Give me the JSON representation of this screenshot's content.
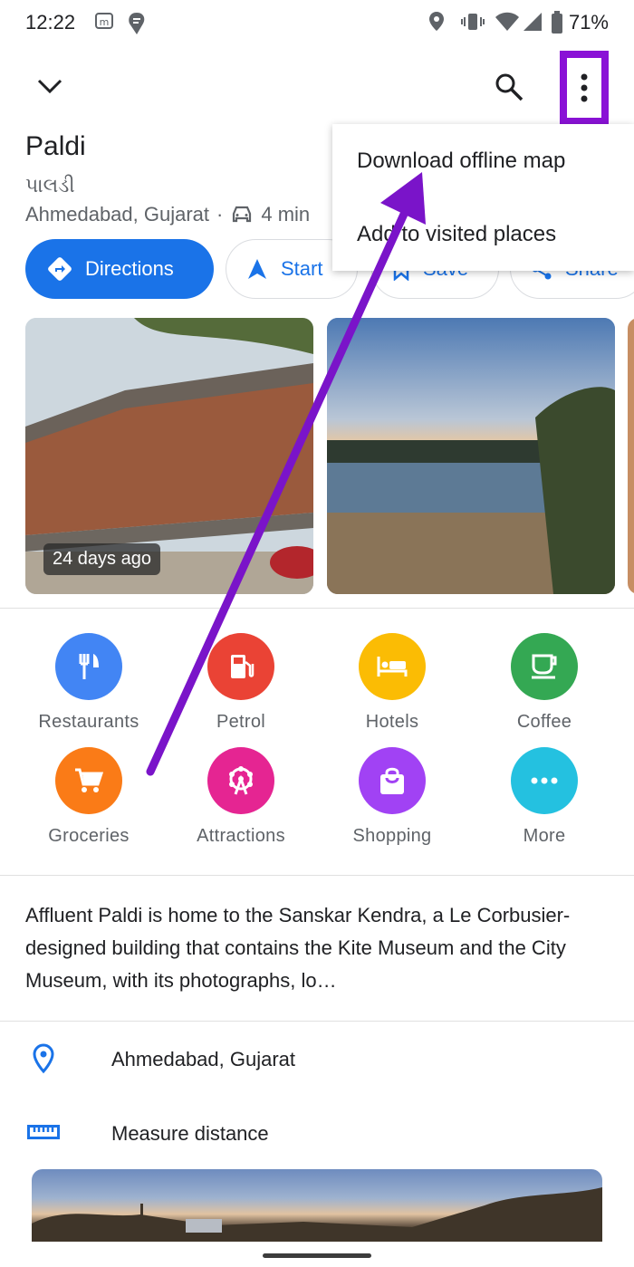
{
  "status_bar": {
    "time": "12:22",
    "battery": "71%"
  },
  "place": {
    "name": "Paldi",
    "local_name": "પાલડી",
    "location": "Ahmedabad, Gujarat",
    "separator": "·",
    "drive_time": "4 min"
  },
  "actions": [
    {
      "label": "Directions",
      "icon": "directions-icon"
    },
    {
      "label": "Start",
      "icon": "navigation-arrow-icon"
    },
    {
      "label": "Save",
      "icon": "bookmark-icon"
    },
    {
      "label": "Share",
      "icon": "share-icon"
    }
  ],
  "photos": {
    "badge": "24 days ago"
  },
  "categories": [
    {
      "label": "Restaurants",
      "color": "#4285f4",
      "icon": "restaurant-icon"
    },
    {
      "label": "Petrol",
      "color": "#ea4335",
      "icon": "gas-station-icon"
    },
    {
      "label": "Hotels",
      "color": "#fbbc04",
      "icon": "hotel-icon"
    },
    {
      "label": "Coffee",
      "color": "#34a853",
      "icon": "coffee-icon"
    },
    {
      "label": "Groceries",
      "color": "#fa7b17",
      "icon": "cart-icon"
    },
    {
      "label": "Attractions",
      "color": "#e52592",
      "icon": "ferris-wheel-icon"
    },
    {
      "label": "Shopping",
      "color": "#a142f4",
      "icon": "shopping-bag-icon"
    },
    {
      "label": "More",
      "color": "#24c1e0",
      "icon": "more-horiz-icon"
    }
  ],
  "description": "Affluent Paldi is home to the Sanskar Kendra, a Le Corbusier-designed building that contains the Kite Museum and the City Museum, with its photographs, lo…",
  "details": [
    {
      "label": "Ahmedabad, Gujarat",
      "icon": "location-pin-icon"
    },
    {
      "label": "Measure distance",
      "icon": "ruler-icon"
    }
  ],
  "overflow_menu": [
    {
      "label": "Download offline map"
    },
    {
      "label": "Add to visited places"
    }
  ],
  "colors": {
    "accent": "#1a73e8",
    "highlight": "#8a12d6"
  }
}
